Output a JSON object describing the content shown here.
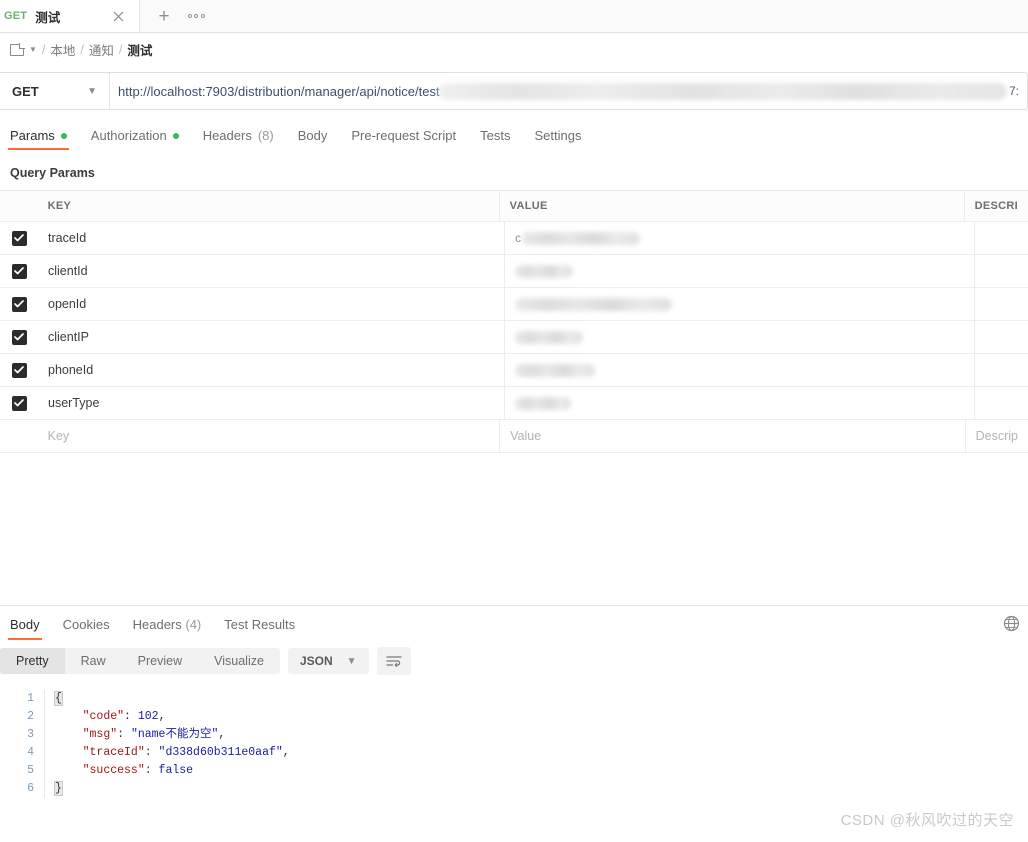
{
  "tab": {
    "method": "GET",
    "title": "测试",
    "close_icon": "close-icon",
    "new_tab_icon": "plus-icon",
    "more_icon": "more-options-icon"
  },
  "breadcrumb": {
    "folder_icon": "folder-icon",
    "caret_icon": "chevron-down-icon",
    "sep": "/",
    "items": [
      "本地",
      "通知",
      "测试"
    ]
  },
  "url_bar": {
    "method": "GET",
    "caret_icon": "chevron-down-icon",
    "url_visible": "http://localhost:7903/distribution/manager/api/notice/test",
    "url_redacted": true,
    "url_tail": "7:"
  },
  "request_tabs": [
    {
      "label": "Params",
      "dot": true,
      "active": true
    },
    {
      "label": "Authorization",
      "dot": true,
      "active": false
    },
    {
      "label": "Headers",
      "count": "(8)",
      "active": false
    },
    {
      "label": "Body",
      "active": false
    },
    {
      "label": "Pre-request Script",
      "active": false
    },
    {
      "label": "Tests",
      "active": false
    },
    {
      "label": "Settings",
      "active": false
    }
  ],
  "params": {
    "section_title": "Query Params",
    "columns": [
      "KEY",
      "VALUE",
      "DESCRI"
    ],
    "rows": [
      {
        "checked": true,
        "key": "traceId",
        "value_redacted": true,
        "value_lead": "c",
        "description": ""
      },
      {
        "checked": true,
        "key": "clientId",
        "value_redacted": true,
        "value_lead": "",
        "description": ""
      },
      {
        "checked": true,
        "key": "openId",
        "value_redacted": true,
        "value_lead": "",
        "description": ""
      },
      {
        "checked": true,
        "key": "clientIP",
        "value_redacted": true,
        "value_lead": "",
        "description": ""
      },
      {
        "checked": true,
        "key": "phoneId",
        "value_redacted": true,
        "value_lead": "",
        "description": ""
      },
      {
        "checked": true,
        "key": "userType",
        "value_redacted": true,
        "value_lead": "",
        "description": ""
      }
    ],
    "empty_row": {
      "key_placeholder": "Key",
      "value_placeholder": "Value",
      "description_placeholder": "Descrip"
    }
  },
  "response": {
    "tabs": [
      {
        "label": "Body",
        "active": true
      },
      {
        "label": "Cookies",
        "active": false
      },
      {
        "label": "Headers",
        "count": "(4)",
        "active": false
      },
      {
        "label": "Test Results",
        "active": false
      }
    ],
    "globe_icon": "globe-icon",
    "view_modes": [
      {
        "label": "Pretty",
        "active": true
      },
      {
        "label": "Raw",
        "active": false
      },
      {
        "label": "Preview",
        "active": false
      },
      {
        "label": "Visualize",
        "active": false
      }
    ],
    "format": "JSON",
    "format_caret_icon": "chevron-down-icon",
    "wrap_icon": "wrap-lines-icon",
    "body_lines": [
      {
        "n": "1",
        "text": "{"
      },
      {
        "n": "2",
        "key": "\"code\"",
        "sep": ": ",
        "val": "102",
        "val_type": "number",
        "trail": ","
      },
      {
        "n": "3",
        "key": "\"msg\"",
        "sep": ": ",
        "val": "\"name不能为空\"",
        "val_type": "string",
        "trail": ","
      },
      {
        "n": "4",
        "key": "\"traceId\"",
        "sep": ": ",
        "val": "\"d338d60b311e0aaf\"",
        "val_type": "string",
        "trail": ","
      },
      {
        "n": "5",
        "key": "\"success\"",
        "sep": ": ",
        "val": "false",
        "val_type": "boolean",
        "trail": ""
      },
      {
        "n": "6",
        "text": "}"
      }
    ]
  },
  "watermark": "CSDN @秋风吹过的天空",
  "colors": {
    "accent": "#ff6c37",
    "method_get": "#6bb26b",
    "dot_green": "#3ab75a",
    "json_key": "#a31515",
    "json_value": "#1a1aa6",
    "gutter": "#7d9ab5"
  }
}
